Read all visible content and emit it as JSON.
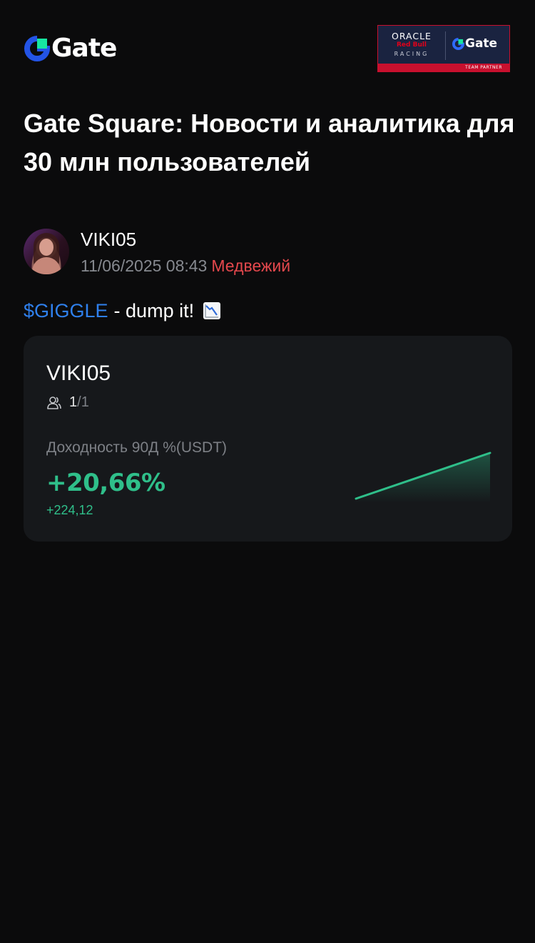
{
  "header": {
    "logo_text": "Gate",
    "partner": {
      "oracle": "ORACLE",
      "redbull": "Red Bull",
      "racing": "RACING",
      "gate": "Gate",
      "ribbon": "TEAM PARTNER"
    }
  },
  "headline": "Gate Square: Новости и аналитика для 30 млн пользователей",
  "post": {
    "author": "VIKI05",
    "timestamp": "11/06/2025 08:43",
    "sentiment": "Медвежий",
    "ticker": "$GIGGLE",
    "body": "- dump it!",
    "emoji_icon": "chart-decreasing-icon"
  },
  "card": {
    "name": "VIKI05",
    "followers_current": "1",
    "followers_separator": "/",
    "followers_max": "1",
    "roi_label": "Доходность 90Д %(USDT)",
    "roi_value": "+20,66%",
    "pnl_value": "+224,12"
  },
  "chart_data": {
    "type": "area",
    "x": [
      0,
      1
    ],
    "values": [
      0,
      20.66
    ],
    "title": "",
    "xlabel": "",
    "ylabel": ""
  },
  "colors": {
    "background": "#0b0b0c",
    "card": "#16181b",
    "positive": "#2fbf8a",
    "bearish": "#e5484d",
    "ticker": "#2f80ed",
    "brand_blue": "#2354e6",
    "brand_green": "#17e6a1"
  }
}
